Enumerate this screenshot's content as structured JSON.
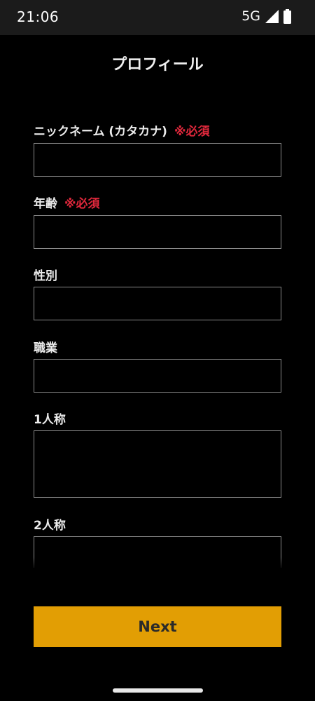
{
  "status_bar": {
    "time": "21:06",
    "network": "5G",
    "icons": [
      "signal-icon",
      "battery-icon"
    ]
  },
  "header": {
    "title": "プロフィール"
  },
  "form": {
    "fields": [
      {
        "label": "ニックネーム (カタカナ)",
        "required": "※必須",
        "value": ""
      },
      {
        "label": "年齢",
        "required": "※必須",
        "value": ""
      },
      {
        "label": "性別",
        "value": ""
      },
      {
        "label": "職業",
        "value": ""
      },
      {
        "label": "1人称",
        "value": ""
      },
      {
        "label": "2人称",
        "value": ""
      }
    ]
  },
  "actions": {
    "next_label": "Next"
  },
  "colors": {
    "background": "#000000",
    "status_bar": "#1b1b1b",
    "accent": "#e29e04",
    "required": "#e0283c",
    "input_border": "#8a8a8a"
  }
}
